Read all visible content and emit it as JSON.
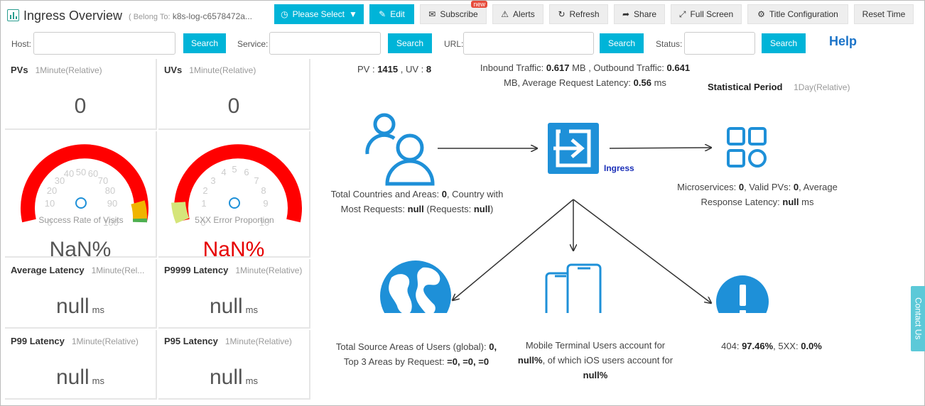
{
  "header": {
    "title": "Ingress Overview",
    "belong_prefix": "( Belong To:",
    "belong_value": "k8s-log-c6578472a...",
    "buttons": {
      "please_select": "Please Select",
      "edit": "Edit",
      "subscribe": "Subscribe",
      "subscribe_badge": "new",
      "alerts": "Alerts",
      "refresh": "Refresh",
      "share": "Share",
      "full_screen": "Full Screen",
      "title_configuration": "Title Configuration",
      "reset_time": "Reset Time"
    }
  },
  "filters": {
    "host_label": "Host:",
    "service_label": "Service:",
    "url_label": "URL:",
    "status_label": "Status:",
    "search_label": "Search",
    "help": "Help"
  },
  "cards": {
    "pvs": {
      "title": "PVs",
      "sub": "1Minute(Relative)",
      "value": "0"
    },
    "uvs": {
      "title": "UVs",
      "sub": "1Minute(Relative)",
      "value": "0"
    },
    "success_gauge": {
      "label": "Success Rate of Visits",
      "value": "NaN%",
      "ticks": [
        "0",
        "10",
        "20",
        "30",
        "40",
        "50",
        "60",
        "70",
        "80",
        "90",
        "100"
      ]
    },
    "error_gauge": {
      "label": "5XX Error Proportion",
      "value": "NaN%",
      "ticks": [
        "0",
        "1",
        "2",
        "3",
        "4",
        "5",
        "6",
        "7",
        "8",
        "9",
        "10"
      ]
    },
    "avg_latency": {
      "title": "Average Latency",
      "sub": "1Minute(Rel...",
      "value": "null",
      "unit": "ms"
    },
    "p9999": {
      "title": "P9999 Latency",
      "sub": "1Minute(Relative)",
      "value": "null",
      "unit": "ms"
    },
    "p99": {
      "title": "P99 Latency",
      "sub": "1Minute(Relative)",
      "value": "null",
      "unit": "ms"
    },
    "p95": {
      "title": "P95 Latency",
      "sub": "1Minute(Relative)",
      "value": "null",
      "unit": "ms"
    }
  },
  "summary": {
    "pv_label": "PV :",
    "pv_value": "1415",
    "uv_label": ", UV :",
    "uv_value": "8",
    "inbound_label": "Inbound Traffic:",
    "inbound_value": "0.617",
    "outbound_label": "MB , Outbound Traffic:",
    "outbound_value": "0.641",
    "latency_label": "MB, Average Request Latency:",
    "latency_value": "0.56",
    "latency_unit": "ms",
    "period_label": "Statistical Period",
    "period_value": "1Day(Relative)"
  },
  "flow": {
    "ingress_label": "Ingress",
    "countries": {
      "t1": "Total Countries and Areas:",
      "v1": "0",
      "t2": ", Country with",
      "t3": "Most Requests:",
      "v2": "null",
      "t4": "(Requests:",
      "v3": "null",
      "t5": ")"
    },
    "microservices": {
      "t1": "Microservices:",
      "v1": "0",
      "t2": ", Valid PVs:",
      "v2": "0",
      "t3": ", Average",
      "t4": "Response Latency:",
      "v3": "null",
      "t5": "ms"
    },
    "source_areas": {
      "t1": "Total Source Areas of Users (global):",
      "v1": "0,",
      "t2": "Top 3 Areas by Request:",
      "v2": "=0,  =0,  =0"
    },
    "mobile": {
      "t1": "Mobile Terminal Users account for",
      "v1": "null%",
      "t2": ", of which iOS users account for",
      "v2": "null%"
    },
    "errors": {
      "t1": "404:",
      "v1": "97.46%",
      "t2": ", 5XX:",
      "v2": "0.0%"
    }
  },
  "contact_us": "Contact Us",
  "colors": {
    "accent": "#00b4d8",
    "icon_blue": "#1e90d8",
    "gauge_red": "#ff0000",
    "nan_red": "#e60000"
  }
}
